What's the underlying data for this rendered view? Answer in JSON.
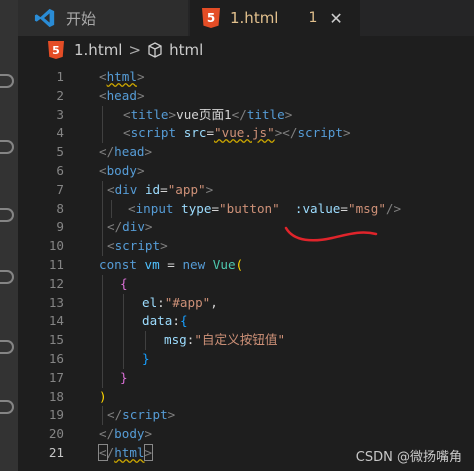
{
  "tabs": [
    {
      "label": "开始",
      "icon": "vscode-icon"
    },
    {
      "label": "1.html",
      "icon": "html5-icon",
      "badge": "1",
      "close": "✕"
    }
  ],
  "breadcrumb": {
    "file": "1.html",
    "sep": ">",
    "symbol": "html"
  },
  "editor": {
    "line_numbers": [
      "1",
      "2",
      "3",
      "4",
      "5",
      "6",
      "7",
      "8",
      "9",
      "10",
      "11",
      "12",
      "13",
      "14",
      "15",
      "16",
      "17",
      "18",
      "19",
      "20",
      "21"
    ],
    "active_line": "21",
    "code": {
      "l1_tag": "html",
      "l2_tag": "head",
      "l3_tag": "title",
      "l3_text": "vue页面1",
      "l3_close": "title",
      "l4_tag": "script",
      "l4_attr": "src",
      "l4_val": "\"vue.js\"",
      "l4_close": "script",
      "l5_tag": "head",
      "l6_tag": "body",
      "l7_tag": "div",
      "l7_attr": "id",
      "l7_val": "\"app\"",
      "l8_tag": "input",
      "l8_attr1": "type",
      "l8_val1": "\"button\"",
      "l8_attr2": ":value",
      "l8_val2": "\"msg\"",
      "l9_tag": "div",
      "l10_tag": "script",
      "l11_kw": "const",
      "l11_var": "vm",
      "l11_op": " = ",
      "l11_new": "new",
      "l11_cls": "Vue",
      "l11_paren": "(",
      "l12_brace": "{",
      "l13_key": "el",
      "l13_val": "\"#app\"",
      "l13_comma": ",",
      "l14_key": "data",
      "l14_brace": "{",
      "l15_key": "msg",
      "l15_val": "\"自定义按钮值\"",
      "l16_brace": "}",
      "l17_brace": "}",
      "l18_paren": ")",
      "l19_tag": "script",
      "l20_tag": "body",
      "l21_tag": "html"
    }
  },
  "watermark": "CSDN @微扬嘴角",
  "colors": {
    "annotation": "#e0242b",
    "accent_tab_text": "#e2c08d"
  }
}
